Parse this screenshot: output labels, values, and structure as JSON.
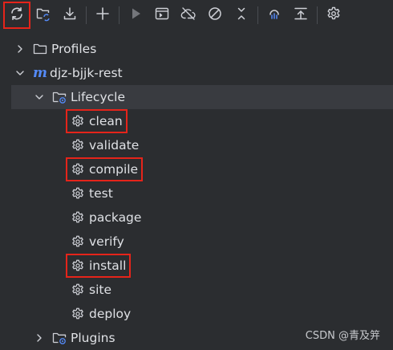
{
  "toolbar": {
    "buttons": [
      {
        "name": "reload-all-maven-projects-button",
        "icon": "refresh-icon",
        "highlighted": true
      },
      {
        "name": "generate-sources-button",
        "icon": "folder-refresh-icon"
      },
      {
        "name": "download-sources-button",
        "icon": "download-icon"
      },
      {
        "name": "add-maven-project-button",
        "icon": "plus-icon"
      },
      {
        "name": "run-maven-build-button",
        "icon": "play-icon"
      },
      {
        "name": "execute-maven-goal-button",
        "icon": "terminal-icon"
      },
      {
        "name": "toggle-offline-mode-button",
        "icon": "cloud-slash-icon"
      },
      {
        "name": "skip-tests-button",
        "icon": "circle-slash-icon"
      },
      {
        "name": "collapse-all-button",
        "icon": "collapse-icon"
      },
      {
        "name": "analyze-dependencies-button",
        "icon": "dependencies-icon"
      },
      {
        "name": "show-dependencies-button",
        "icon": "upload-tree-icon"
      },
      {
        "name": "maven-settings-button",
        "icon": "gear-icon"
      }
    ]
  },
  "tree": {
    "profiles": {
      "label": "Profiles",
      "expanded": false
    },
    "project": {
      "label": "djz-bjjk-rest",
      "expanded": true,
      "icon": "maven-m-icon"
    },
    "lifecycle": {
      "label": "Lifecycle",
      "expanded": true,
      "selected": true
    },
    "goals": [
      {
        "label": "clean",
        "highlighted": true
      },
      {
        "label": "validate",
        "highlighted": false
      },
      {
        "label": "compile",
        "highlighted": true
      },
      {
        "label": "test",
        "highlighted": false
      },
      {
        "label": "package",
        "highlighted": false
      },
      {
        "label": "verify",
        "highlighted": false
      },
      {
        "label": "install",
        "highlighted": true
      },
      {
        "label": "site",
        "highlighted": false
      },
      {
        "label": "deploy",
        "highlighted": false
      }
    ],
    "plugins": {
      "label": "Plugins",
      "expanded": false
    }
  },
  "watermark": "CSDN @青及笄",
  "colors": {
    "background": "#2b2d30",
    "selection": "#393b40",
    "highlight_box": "#e5241a",
    "maven_blue": "#548af7",
    "text": "#dfe1e5",
    "icon": "#ced0d6"
  }
}
